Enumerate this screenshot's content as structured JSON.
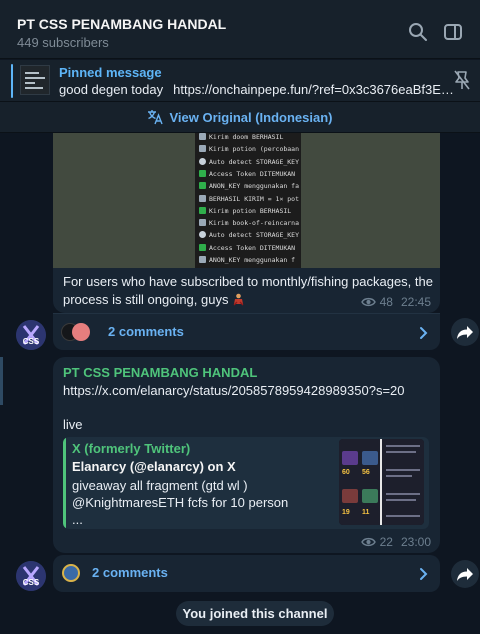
{
  "header": {
    "title": "PT CSS PENAMBANG HANDAL",
    "subscribers": "449 subscribers",
    "icons": [
      "search-icon",
      "sidebar-toggle-icon"
    ]
  },
  "pinned": {
    "label": "Pinned message",
    "text": "good degen today",
    "url": "https://onchainpepe.fun/?ref=0x3c3676eaBf3E18..."
  },
  "translate": {
    "label": "View Original (Indonesian)"
  },
  "post1": {
    "terminal_lines": [
      {
        "icon": "blue",
        "text": "Kirim doom BERHASIL"
      },
      {
        "icon": "blue",
        "text": "Kirim potion (percobaan"
      },
      {
        "icon": "white",
        "text": "Auto detect STORAGE_KEY"
      },
      {
        "icon": "green",
        "text": "Access Token DITEMUKAN ("
      },
      {
        "icon": "green",
        "text": "ANON_KEY menggunakan fal"
      },
      {
        "icon": "blue",
        "text": "BERHASIL KIRIM = 1× poti"
      },
      {
        "icon": "green",
        "text": "Kirim potion BERHASIL"
      },
      {
        "icon": "blue",
        "text": "Kirim book-of-reincarnat"
      },
      {
        "icon": "white",
        "text": "Auto detect STORAGE_KEY"
      },
      {
        "icon": "green",
        "text": "Access Token DITEMUKAN ("
      },
      {
        "icon": "blue",
        "text": "ANON_KEY menggunakan f"
      }
    ],
    "text_line1": "For users who have subscribed to monthly/fishing packages, the",
    "text_line2": "process is still ongoing, guys",
    "views": "48",
    "time": "22:45",
    "comments": "2 comments"
  },
  "post2": {
    "sender": "PT CSS PENAMBANG HANDAL",
    "link": "https://x.com/elanarcy/status/2058578959428989350?s=20",
    "text": "live",
    "preview": {
      "site": "X (formerly Twitter)",
      "title": "Elanarcy (@elanarcy) on X",
      "desc1": "giveaway all fragment (gtd wl )",
      "desc2": "@KnightmaresETH  fcfs for 10 person",
      "desc3": "...",
      "img_nums": [
        "60",
        "56",
        "19",
        "11"
      ]
    },
    "views": "22",
    "time": "23:00",
    "comments": "2 comments"
  },
  "avatar_label": "CSS",
  "joined": "You joined this channel"
}
